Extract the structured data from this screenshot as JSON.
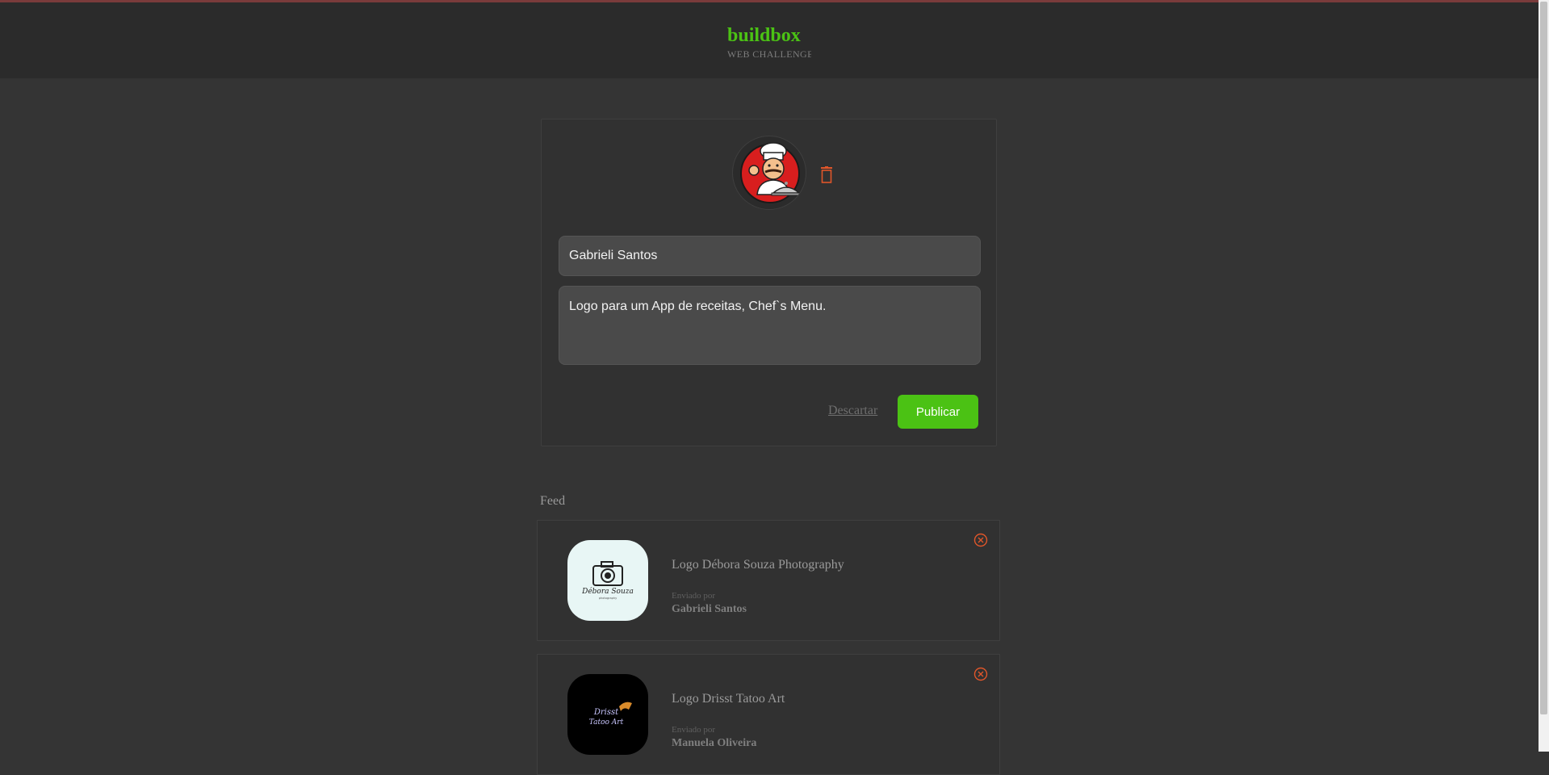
{
  "header": {
    "brand": "buildbox",
    "subtitle": "WEB CHALLENGE",
    "accent_color": "#4bc214"
  },
  "composer": {
    "avatar": "chef-logo-image",
    "remove_icon": "trash-icon",
    "name_value": "Gabrieli Santos",
    "message_value": "Logo para um App de receitas, Chef`s Menu.",
    "discard_label": "Descartar",
    "publish_label": "Publicar"
  },
  "feed": {
    "title": "Feed",
    "posts": [
      {
        "message": "Logo Débora Souza Photography",
        "sent_by_label": "Enviado por",
        "author": "Gabrieli Santos",
        "image": "camera-logo-image",
        "logo_text": "Débora Souza",
        "logo_subtext": "photography",
        "close_icon": "close-circle-icon"
      },
      {
        "message": "Logo Drisst Tatoo Art",
        "sent_by_label": "Enviado por",
        "author": "Manuela Oliveira",
        "image": "tattoo-logo-image",
        "logo_text_1": "Drisst",
        "logo_text_2": "Tatoo Art",
        "close_icon": "close-circle-icon"
      }
    ]
  }
}
